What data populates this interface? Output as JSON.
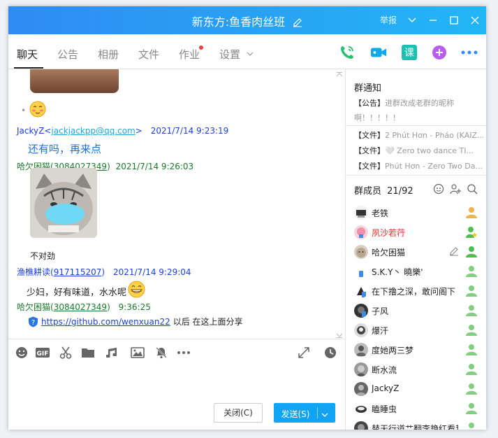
{
  "window": {
    "title": "新东方:鱼香肉丝班",
    "report": "举报"
  },
  "tabs": [
    {
      "label": "聊天"
    },
    {
      "label": "公告"
    },
    {
      "label": "相册"
    },
    {
      "label": "文件"
    },
    {
      "label": "作业"
    },
    {
      "label": "设置"
    }
  ],
  "chat": {
    "messages": [
      {
        "sender": "JackyZ",
        "open": "<",
        "contact": "jackjackpp@qq.com",
        "close": ">",
        "time": "2021/7/14 9:23:19",
        "text": "还有吗，再来点"
      },
      {
        "sender": "哈欠困猫",
        "open": "(",
        "contact": "3084027349",
        "close": ")",
        "time": "2021/7/14 9:26:03",
        "text": "不对劲"
      },
      {
        "sender": "渔樵耕读",
        "open": "(",
        "contact": "917115207",
        "close": ")",
        "time": "2021/7/14 9:29:04",
        "text": "少妇，好有味道，水水呢"
      },
      {
        "sender": "哈欠困猫",
        "open": "(",
        "contact": "3084027349",
        "close": ")",
        "time": "9:36:25",
        "link": "https://github.com/wenxuan22",
        "text": "以后 在这上面分享"
      }
    ]
  },
  "input": {
    "close_label": "关闭(C)",
    "send_label": "发送(S)"
  },
  "sidebar": {
    "notice_title": "群通知",
    "announcement_tag": "【公告】",
    "announcement_text": "进群改成老群的昵称",
    "announcement_text2": "啊！！！！！",
    "files": [
      {
        "tag": "【文件】",
        "name": "2 Phút Hơn - Pháo (KAIZ..."
      },
      {
        "tag": "【文件】",
        "name": "🤍 Zero two dance TI..."
      },
      {
        "tag": "【文件】",
        "name": "Phút Hơn - Zero Two Da..."
      }
    ],
    "members_label": "群成员",
    "members_count": "21/92",
    "members": [
      {
        "name": "老铁",
        "role": "owner"
      },
      {
        "name": "夙沙若荇",
        "role": "admin-star"
      },
      {
        "name": "哈欠困猫",
        "role": "admin"
      },
      {
        "name": "S.K.Y丶 曉樂'",
        "role": "member"
      },
      {
        "name": "在下撸之深，敢问阁下",
        "role": "member"
      },
      {
        "name": "子风",
        "role": "member"
      },
      {
        "name": "爆汗",
        "role": "member"
      },
      {
        "name": "度她两三梦",
        "role": "member"
      },
      {
        "name": "断水流",
        "role": "member"
      },
      {
        "name": "JackyZ",
        "role": "member"
      },
      {
        "name": "瞌睡虫",
        "role": "member"
      },
      {
        "name": "替天行道艹翻李艳红看我",
        "role": "member"
      }
    ]
  },
  "colors": {
    "titlebar_start": "#2f8bf3",
    "titlebar_end": "#22b6f5",
    "send_button": "#11a4f4",
    "sender_blue": "#1e40d9",
    "sender_green": "#1a7a2c"
  }
}
